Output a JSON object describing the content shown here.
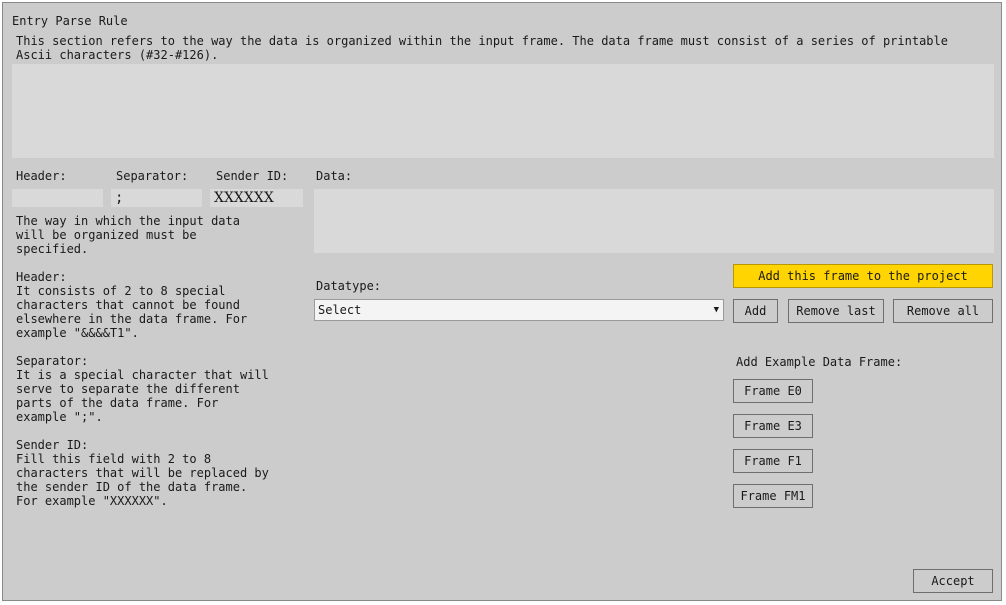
{
  "title": "Entry Parse Rule",
  "description": "This section refers to the way the data is organized within the input frame. The data frame must consist of a series of printable\nAscii characters (#32-#126).",
  "labels": {
    "header": "Header:",
    "separator": "Separator:",
    "sender_id": "Sender ID:",
    "data": "Data:",
    "datatype": "Datatype:",
    "add_example": "Add Example Data Frame:"
  },
  "fields": {
    "header_value": "",
    "separator_value": ";",
    "sender_id_value": "XXXXXX",
    "data_value": ""
  },
  "help": {
    "intro": "The way in which the input data\nwill be organized must be\nspecified.",
    "header": "Header:\nIt consists of 2 to 8 special\ncharacters that cannot be found\nelsewhere in the data frame. For\nexample \"&&&&T1\".",
    "separator": "Separator:\nIt is a special character that will\nserve to separate the different\nparts of the data frame. For\nexample \";\".",
    "sender_id": "Sender ID:\nFill this field with 2 to 8\ncharacters that will be replaced by\nthe sender ID of the data frame.\nFor example \"XXXXXX\"."
  },
  "datatype_select": {
    "value": "Select",
    "arrow": "▼"
  },
  "buttons": {
    "add_frame": "Add this frame to the project",
    "add": "Add",
    "remove_last": "Remove last",
    "remove_all": "Remove all",
    "frame_e0": "Frame E0",
    "frame_e3": "Frame E3",
    "frame_f1": "Frame F1",
    "frame_fm1": "Frame FM1",
    "accept": "Accept"
  },
  "colors": {
    "accent": "#ffd400",
    "background": "#cccccc",
    "field": "#d9d9d9"
  }
}
